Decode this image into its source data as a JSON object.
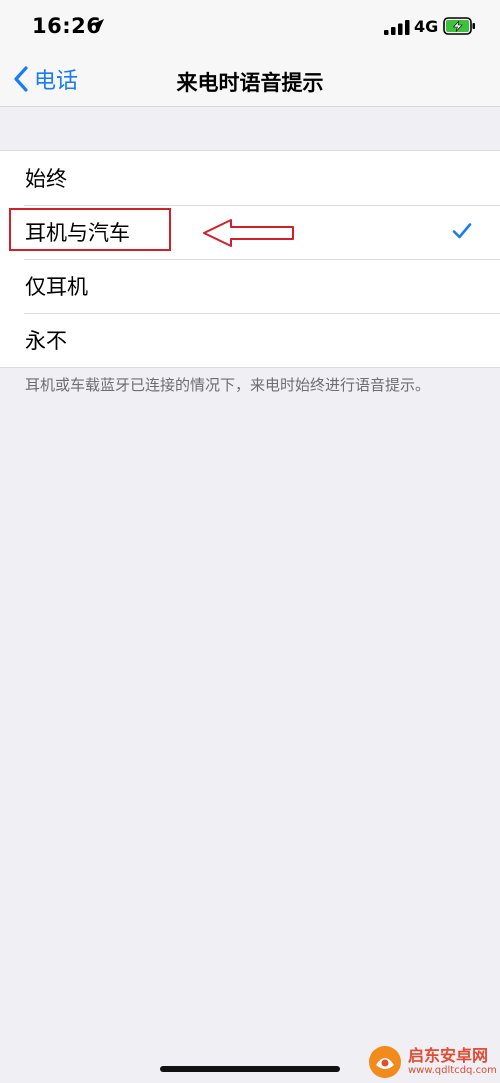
{
  "status_bar": {
    "time": "16:26",
    "network": "4G",
    "icons": [
      "location-arrow-icon",
      "cellular-signal-icon",
      "battery-charging-icon"
    ]
  },
  "nav": {
    "back_label": "电话",
    "title": "来电时语音提示"
  },
  "options": [
    {
      "label": "始终",
      "selected": false
    },
    {
      "label": "耳机与汽车",
      "selected": true
    },
    {
      "label": "仅耳机",
      "selected": false
    },
    {
      "label": "永不",
      "selected": false
    }
  ],
  "footer_note": "耳机或车载蓝牙已连接的情况下，来电时始终进行语音提示。",
  "watermark": {
    "name": "启东安卓网",
    "url": "www.qdltcdq.com"
  },
  "colors": {
    "accent": "#1a7cf5",
    "annotation": "#d2202a",
    "background": "#efeff4"
  }
}
